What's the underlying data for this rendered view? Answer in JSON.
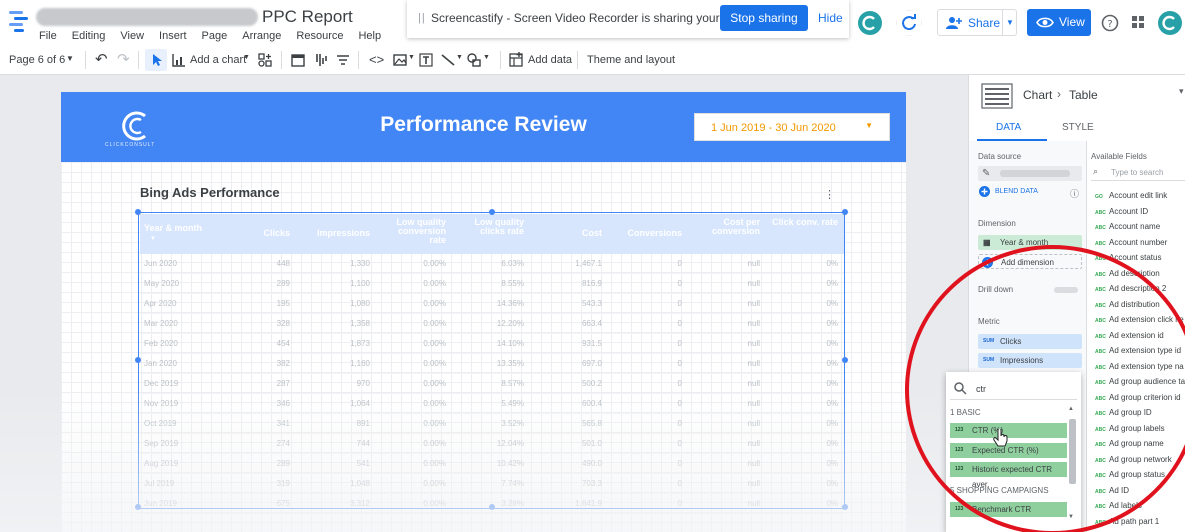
{
  "app": {
    "title": "PPC Report",
    "menu": [
      "File",
      "Editing",
      "View",
      "Insert",
      "Page",
      "Arrange",
      "Resource",
      "Help"
    ]
  },
  "banner": {
    "text": "Screencastify - Screen Video Recorder is sharing your screen.",
    "stop_label": "Stop sharing",
    "hide_label": "Hide"
  },
  "header_actions": {
    "share_label": "Share",
    "view_label": "View"
  },
  "toolbar": {
    "page_label": "Page 6 of 6",
    "add_chart_label": "Add a chart",
    "add_data_label": "Add data",
    "theme_label": "Theme and layout"
  },
  "report": {
    "title": "Performance Review",
    "brand": "CLICKCONSULT",
    "date_range": "1 Jun 2019 - 30 Jun 2020",
    "section_title": "Bing Ads Performance",
    "columns": [
      "Year & month",
      "Clicks",
      "Impressions",
      "Low quality conversion rate",
      "Low quality clicks rate",
      "Cost",
      "Conversions",
      "Cost per conversion",
      "Click conv. rate"
    ],
    "rows": [
      [
        "Jun 2020",
        "448",
        "1,330",
        "0.00%",
        "6.03%",
        "1,467.1",
        "0",
        "null",
        "0%"
      ],
      [
        "May 2020",
        "289",
        "1,100",
        "0.00%",
        "8.55%",
        "816.9",
        "0",
        "null",
        "0%"
      ],
      [
        "Apr 2020",
        "195",
        "1,080",
        "0.00%",
        "14.36%",
        "543.3",
        "0",
        "null",
        "0%"
      ],
      [
        "Mar 2020",
        "328",
        "1,358",
        "0.00%",
        "12.20%",
        "663.4",
        "0",
        "null",
        "0%"
      ],
      [
        "Feb 2020",
        "454",
        "1,873",
        "0.00%",
        "14.10%",
        "931.5",
        "0",
        "null",
        "0%"
      ],
      [
        "Jan 2020",
        "382",
        "1,160",
        "0.00%",
        "13.35%",
        "697.0",
        "0",
        "null",
        "0%"
      ],
      [
        "Dec 2019",
        "287",
        "970",
        "0.00%",
        "8.57%",
        "500.2",
        "0",
        "null",
        "0%"
      ],
      [
        "Nov 2019",
        "346",
        "1,064",
        "0.00%",
        "5.49%",
        "600.4",
        "0",
        "null",
        "0%"
      ],
      [
        "Oct 2019",
        "341",
        "891",
        "0.00%",
        "3.52%",
        "565.8",
        "0",
        "null",
        "0%"
      ],
      [
        "Sep 2019",
        "274",
        "744",
        "0.00%",
        "12.04%",
        "501.0",
        "0",
        "null",
        "0%"
      ],
      [
        "Aug 2019",
        "289",
        "541",
        "0.00%",
        "10.42%",
        "490.0",
        "0",
        "null",
        "0%"
      ],
      [
        "Jul 2019",
        "319",
        "1,048",
        "0.00%",
        "7.74%",
        "703.3",
        "0",
        "null",
        "0%"
      ],
      [
        "Jun 2019",
        "675",
        "3,312",
        "0.00%",
        "3.28%",
        "1,641.9",
        "0",
        "null",
        "0%"
      ]
    ]
  },
  "panel": {
    "breadcrumb_chart": "Chart",
    "breadcrumb_type": "Table",
    "tab_data": "DATA",
    "tab_style": "STYLE",
    "data_source_label": "Data source",
    "blend_label": "BLEND DATA",
    "dimension_label": "Dimension",
    "dimension_value": "Year & month",
    "add_dimension": "Add dimension",
    "drill_down_label": "Drill down",
    "metric_label": "Metric",
    "metrics": [
      {
        "tag": "SUM",
        "name": "Clicks"
      },
      {
        "tag": "SUM",
        "name": "Impressions"
      }
    ],
    "available_fields_label": "Available Fields",
    "search_placeholder": "Type to search",
    "fields": [
      {
        "tag": "GO",
        "name": "Account edit link"
      },
      {
        "tag": "ABC",
        "name": "Account ID"
      },
      {
        "tag": "ABC",
        "name": "Account name"
      },
      {
        "tag": "ABC",
        "name": "Account number"
      },
      {
        "tag": "ABC",
        "name": "Account status"
      },
      {
        "tag": "ABC",
        "name": "Ad description"
      },
      {
        "tag": "ABC",
        "name": "Ad description 2"
      },
      {
        "tag": "ABC",
        "name": "Ad distribution"
      },
      {
        "tag": "ABC",
        "name": "Ad extension click ite"
      },
      {
        "tag": "ABC",
        "name": "Ad extension id"
      },
      {
        "tag": "ABC",
        "name": "Ad extension type id"
      },
      {
        "tag": "ABC",
        "name": "Ad extension type na"
      },
      {
        "tag": "ABC",
        "name": "Ad group audience ta"
      },
      {
        "tag": "ABC",
        "name": "Ad group criterion id"
      },
      {
        "tag": "ABC",
        "name": "Ad group ID"
      },
      {
        "tag": "ABC",
        "name": "Ad group labels"
      },
      {
        "tag": "ABC",
        "name": "Ad group name"
      },
      {
        "tag": "ABC",
        "name": "Ad group network"
      },
      {
        "tag": "ABC",
        "name": "Ad group status"
      },
      {
        "tag": "ABC",
        "name": "Ad ID"
      },
      {
        "tag": "ABC",
        "name": "Ad labels"
      },
      {
        "tag": "ABC",
        "name": "Ad path part 1"
      }
    ]
  },
  "dropdown": {
    "query": "ctr",
    "group1": "1 BASIC",
    "items1": [
      {
        "tag": "123",
        "name": "CTR (%)"
      },
      {
        "tag": "123",
        "name": "Expected CTR (%)"
      },
      {
        "tag": "123",
        "name": "Historic expected CTR aver."
      }
    ],
    "group2": "5 SHOPPING CAMPAIGNS",
    "items2": [
      {
        "tag": "123",
        "name": "Benchmark CTR"
      }
    ]
  },
  "colors": {
    "accent": "#1a73e8",
    "header_blue": "#4285f4",
    "date_orange": "#f29900",
    "annotation_red": "#e0121e"
  }
}
